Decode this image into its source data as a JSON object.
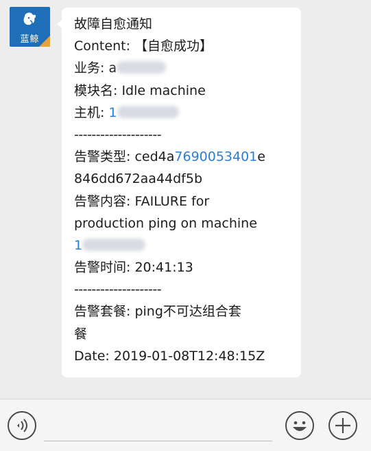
{
  "avatar": {
    "name": "蓝鲸"
  },
  "message": {
    "title": "故障自愈通知",
    "content_label": "Content:",
    "content_value": "【自愈成功】",
    "business_label": "业务:",
    "business_value": "a",
    "module_label": "模块名:",
    "module_value": "Idle machine",
    "host_label": "主机:",
    "host_value": "1",
    "separator": "--------------------",
    "alert_type_label": "告警类型:",
    "alert_type_part1": "ced4a",
    "alert_type_link": "7690053401",
    "alert_type_part2": "e",
    "alert_type_line2": "846dd672aa44df5b",
    "alert_content_label": "告警内容:",
    "alert_content_value": "FAILURE for",
    "alert_content_line2": "production ping on machine",
    "alert_content_line3": "1",
    "alert_time_label": "告警时间:",
    "alert_time_value": "20:41:13",
    "separator2": "--------------------",
    "package_label": "告警套餐:",
    "package_value": "ping不可达组合套",
    "package_line2": "餐",
    "date_line": "Date: 2019-01-08T12:48:15Z"
  },
  "footer": {
    "voice_icon": "voice-icon",
    "emoji_icon": "emoji-icon",
    "plus_icon": "plus-icon"
  }
}
